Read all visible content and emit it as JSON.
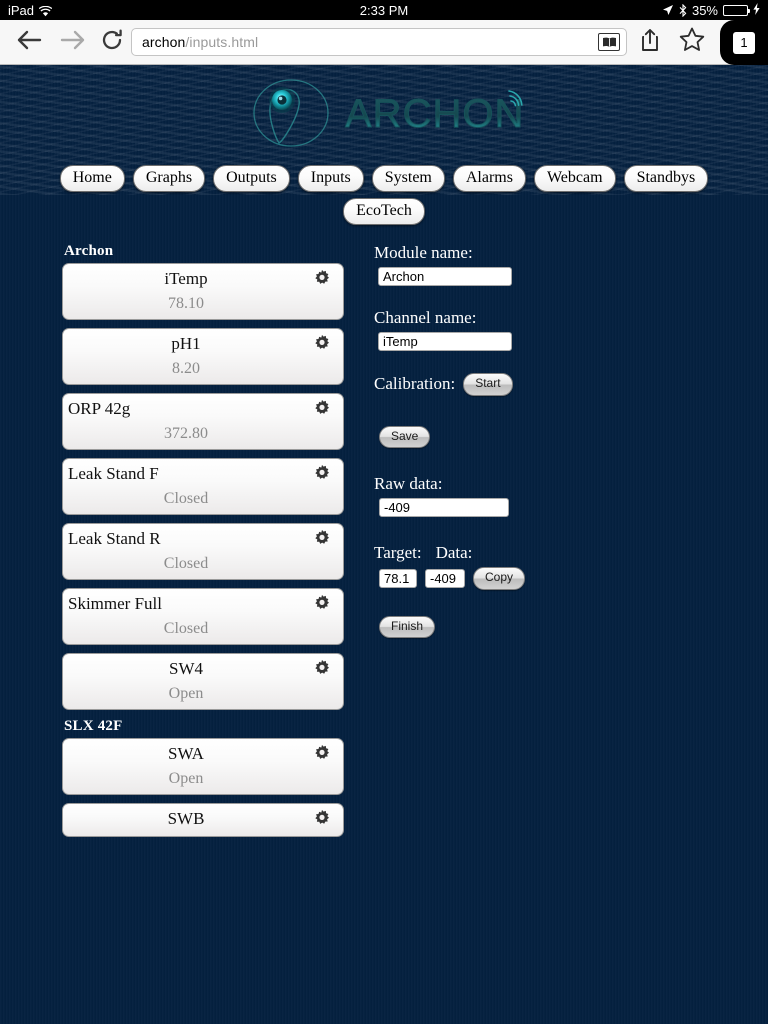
{
  "status_bar": {
    "device": "iPad",
    "wifi_icon": "wifi-icon",
    "time": "2:33 PM",
    "location_icon": "location-arrow-icon",
    "bluetooth_icon": "bluetooth-icon",
    "battery_percent": "35%",
    "battery_icon": "battery-icon",
    "charging_icon": "lightning-bolt-icon"
  },
  "browser": {
    "back_icon": "back-arrow-icon",
    "forward_icon": "forward-arrow-icon",
    "reload_icon": "reload-icon",
    "url_host": "archon",
    "url_path": "/inputs.html",
    "reader_icon": "reader-book-icon",
    "share_icon": "share-icon",
    "bookmark_icon": "bookmark-star-icon",
    "tab_count": "1"
  },
  "logo": {
    "wordmark": "ARCHON",
    "mark_icon": "archon-swirl-icon",
    "signal_icon": "wifi-signal-icon",
    "accent_color": "#1fb9c4",
    "word_color": "#1b5c63"
  },
  "nav": {
    "row1": [
      {
        "label": "Home",
        "name": "nav-home"
      },
      {
        "label": "Graphs",
        "name": "nav-graphs"
      },
      {
        "label": "Outputs",
        "name": "nav-outputs"
      },
      {
        "label": "Inputs",
        "name": "nav-inputs"
      },
      {
        "label": "System",
        "name": "nav-system"
      },
      {
        "label": "Alarms",
        "name": "nav-alarms"
      },
      {
        "label": "Webcam",
        "name": "nav-webcam"
      },
      {
        "label": "Standbys",
        "name": "nav-standbys"
      }
    ],
    "row2": [
      {
        "label": "EcoTech",
        "name": "nav-ecotech"
      }
    ]
  },
  "channel_list": {
    "groups": [
      {
        "header": "Archon",
        "items": [
          {
            "name": "iTemp",
            "value": "78.10",
            "align": "center"
          },
          {
            "name": "pH1",
            "value": "8.20",
            "align": "center"
          },
          {
            "name": "ORP 42g",
            "value": "372.80",
            "align": "left"
          },
          {
            "name": "Leak Stand F",
            "value": "Closed",
            "align": "left"
          },
          {
            "name": "Leak Stand R",
            "value": "Closed",
            "align": "left"
          },
          {
            "name": "Skimmer Full",
            "value": "Closed",
            "align": "left"
          },
          {
            "name": "SW4",
            "value": "Open",
            "align": "center"
          }
        ]
      },
      {
        "header": "SLX 42F",
        "items": [
          {
            "name": "SWA",
            "value": "Open",
            "align": "center"
          },
          {
            "name": "SWB",
            "value": "",
            "align": "center"
          }
        ]
      }
    ],
    "gear_icon": "gear-icon"
  },
  "form": {
    "module_label": "Module name:",
    "module_value": "Archon",
    "channel_label": "Channel name:",
    "channel_value": "iTemp",
    "calibration_label": "Calibration:",
    "start_button": "Start",
    "save_button": "Save",
    "raw_label": "Raw data:",
    "raw_value": "-409",
    "target_label": "Target:",
    "data_label": "Data:",
    "target_value": "78.1",
    "data_value": "-409",
    "copy_button": "Copy",
    "finish_button": "Finish"
  }
}
